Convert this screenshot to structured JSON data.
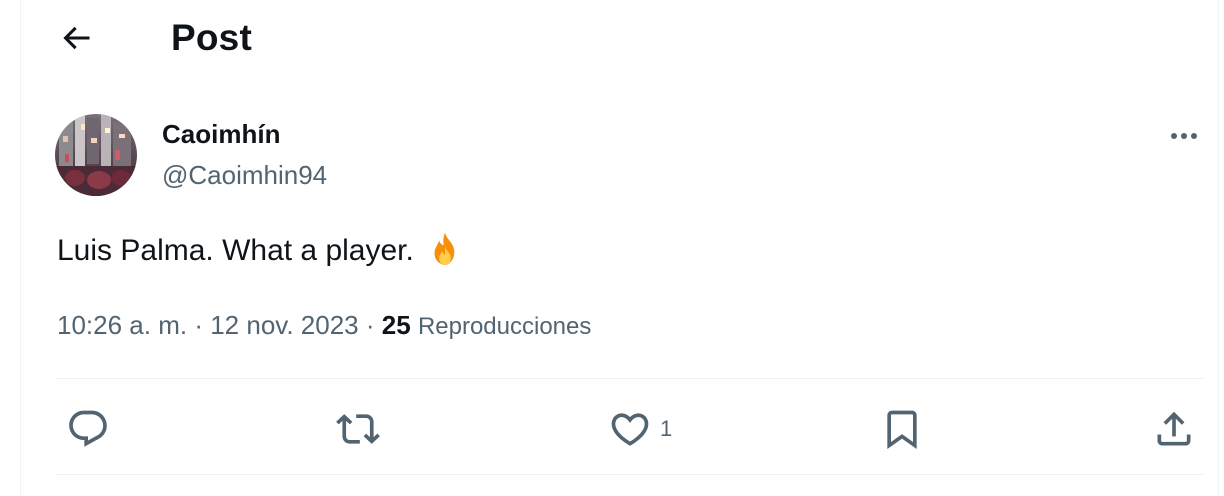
{
  "header": {
    "title": "Post",
    "back_icon": "arrow-left-icon"
  },
  "post": {
    "author": {
      "display_name": "Caoimhín",
      "handle": "@Caoimhin94"
    },
    "text": "Luis Palma. What a player.",
    "emoji": "fire-icon",
    "meta": {
      "time": "10:26 a. m.",
      "separator": "·",
      "date": "12 nov. 2023",
      "views_count": "25",
      "views_label": "Reproducciones"
    },
    "actions": {
      "reply_icon": "reply-icon",
      "repost_icon": "repost-icon",
      "like_icon": "heart-icon",
      "like_count": "1",
      "bookmark_icon": "bookmark-icon",
      "share_icon": "share-icon"
    }
  },
  "colors": {
    "text_primary": "#0f1419",
    "text_secondary": "#536471",
    "divider": "#eff3f4"
  }
}
